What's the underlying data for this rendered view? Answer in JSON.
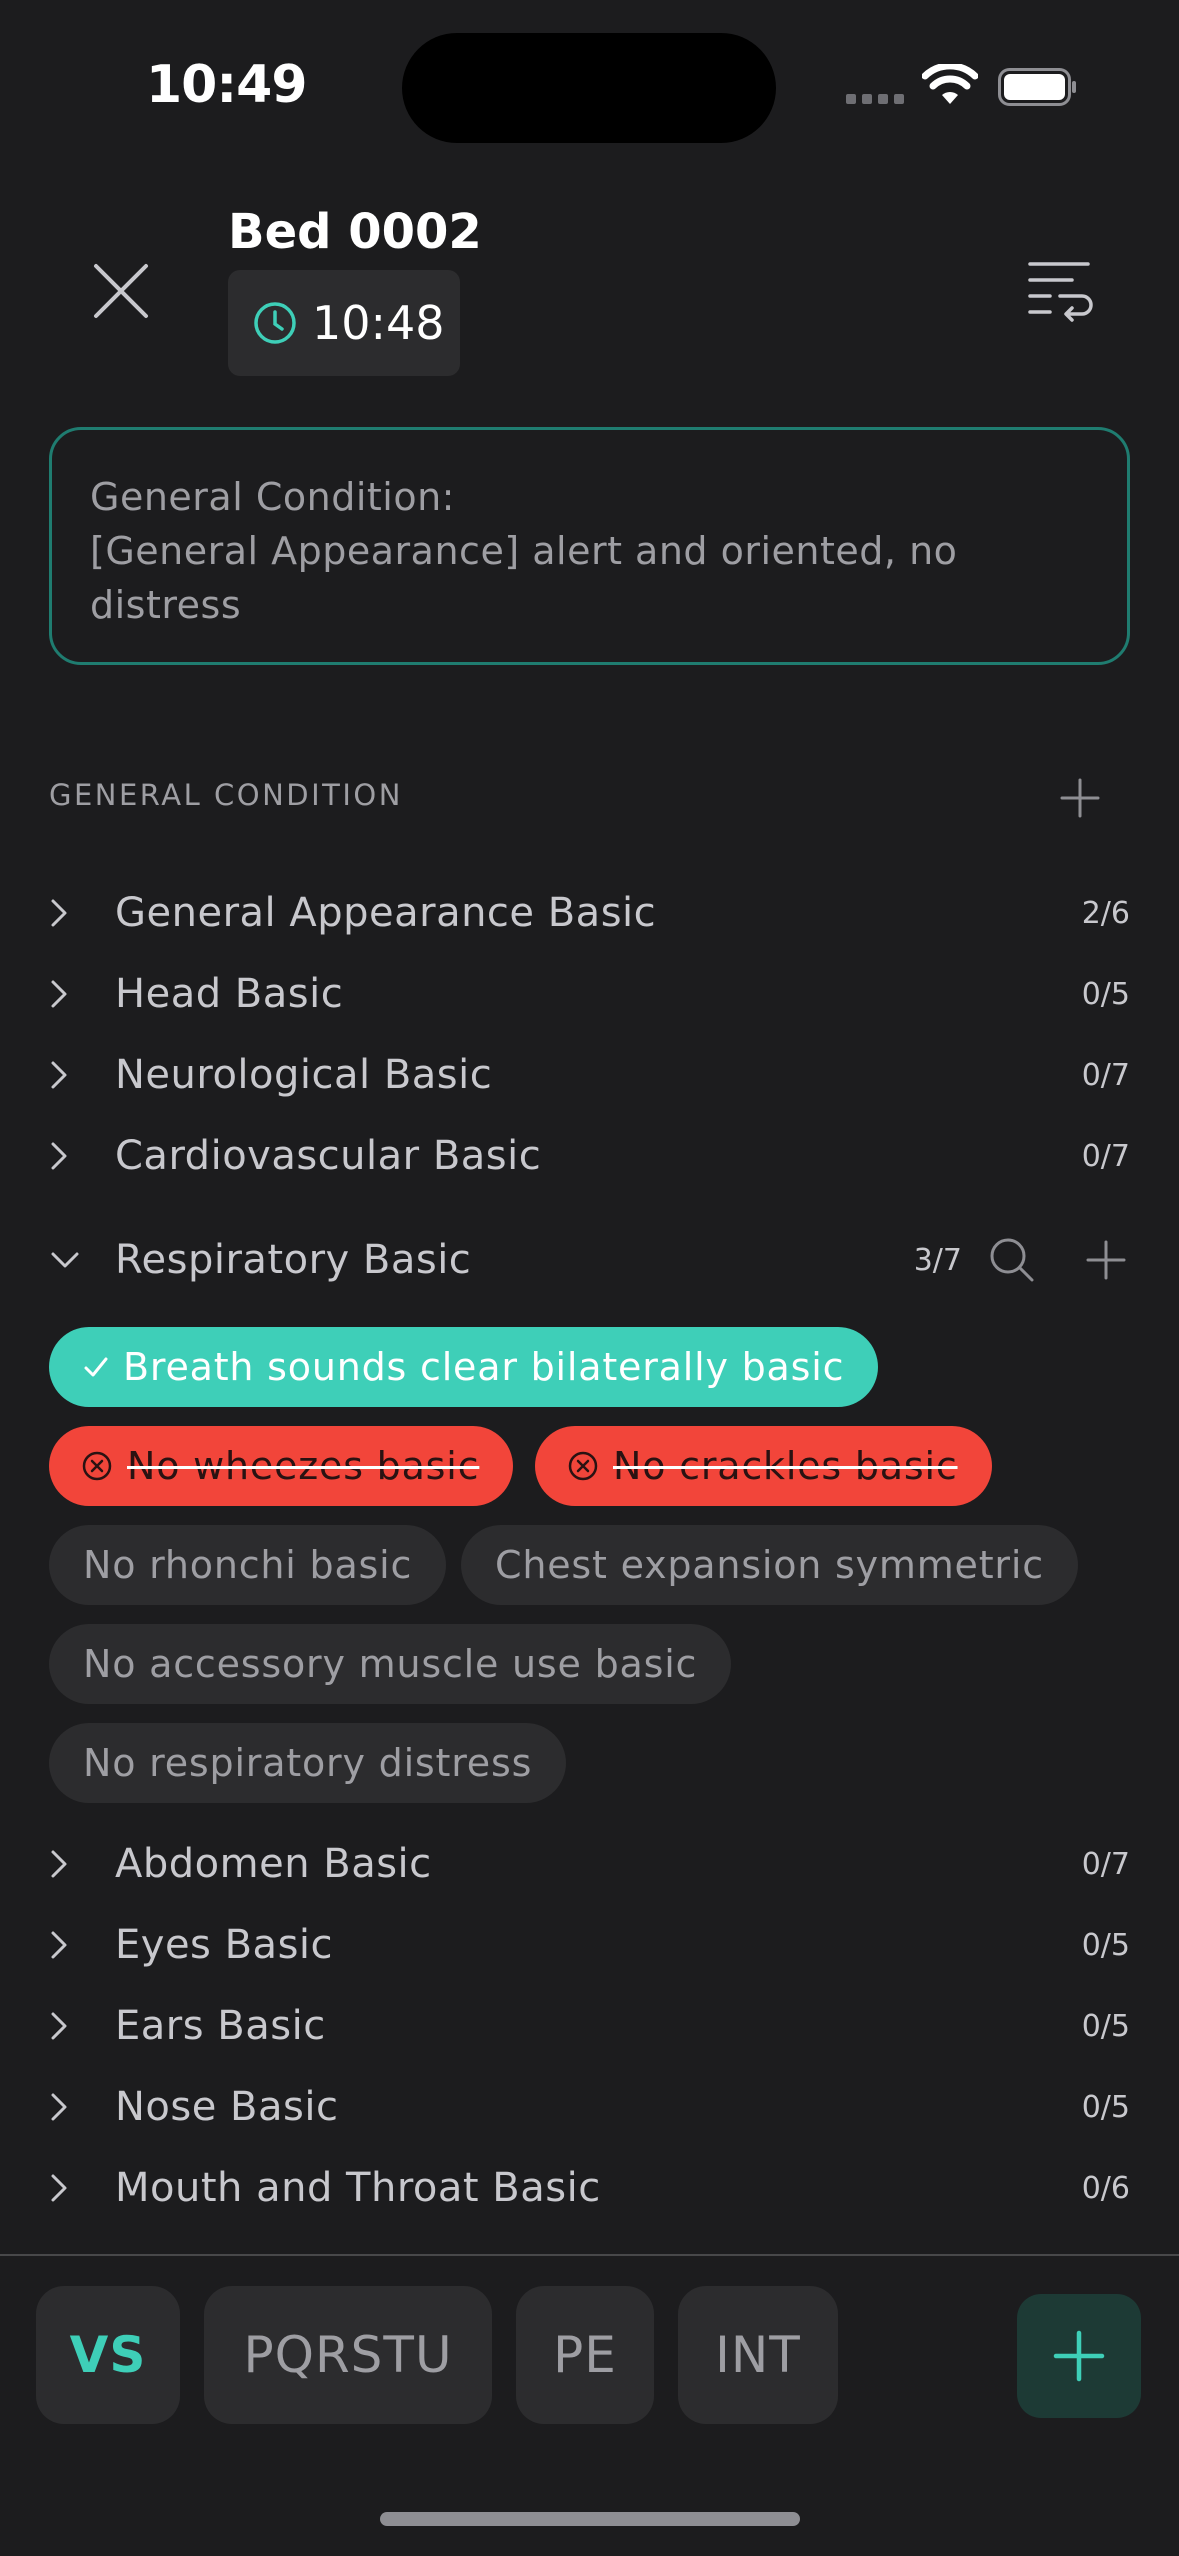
{
  "status_bar": {
    "time": "10:49"
  },
  "header": {
    "title": "Bed 0002",
    "time": "10:48"
  },
  "summary": {
    "line1": "General Condition:",
    "line2": "[General Appearance] alert and oriented, no distress"
  },
  "section": {
    "title": "GENERAL CONDITION"
  },
  "rows_top": [
    {
      "label": "General Appearance Basic",
      "count": "2/6"
    },
    {
      "label": "Head Basic",
      "count": "0/5"
    },
    {
      "label": "Neurological Basic",
      "count": "0/7"
    },
    {
      "label": "Cardiovascular Basic",
      "count": "0/7"
    }
  ],
  "expanded": {
    "label": "Respiratory Basic",
    "count": "3/7",
    "chips": [
      {
        "text": "Breath sounds clear bilaterally basic",
        "state": "selected"
      },
      {
        "text": "No wheezes basic",
        "state": "excluded"
      },
      {
        "text": "No crackles basic",
        "state": "excluded"
      },
      {
        "text": "No rhonchi basic",
        "state": "neutral"
      },
      {
        "text": "Chest expansion symmetric",
        "state": "neutral"
      },
      {
        "text": "No accessory muscle use basic",
        "state": "neutral"
      },
      {
        "text": "No respiratory distress",
        "state": "neutral"
      }
    ]
  },
  "rows_bottom": [
    {
      "label": "Abdomen Basic",
      "count": "0/7"
    },
    {
      "label": "Eyes Basic",
      "count": "0/5"
    },
    {
      "label": "Ears Basic",
      "count": "0/5"
    },
    {
      "label": "Nose Basic",
      "count": "0/5"
    },
    {
      "label": "Mouth and Throat Basic",
      "count": "0/6"
    }
  ],
  "tabs": [
    {
      "label": "VS",
      "active": true
    },
    {
      "label": "PQRSTU",
      "active": false
    },
    {
      "label": "PE",
      "active": false
    },
    {
      "label": "INT",
      "active": false
    }
  ],
  "colors": {
    "accent": "#3ecfb8",
    "excluded": "#f2453a",
    "background": "#1c1c1e",
    "chip_neutral": "#2c2c2e"
  }
}
